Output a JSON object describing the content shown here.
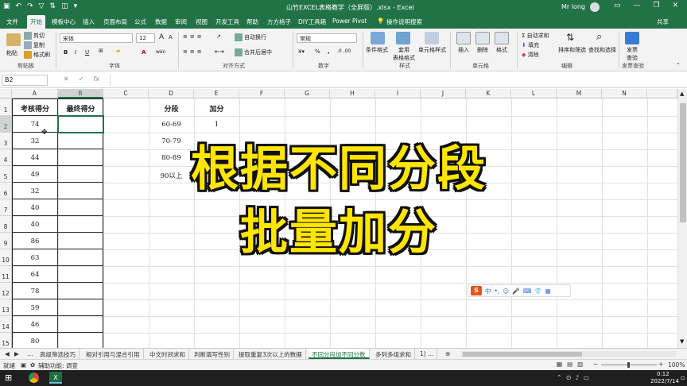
{
  "titlebar": {
    "title": "山竹EXCEL表格教学（全屏版）.xlsx  -  Excel",
    "user": "Mr long",
    "qat_icons": [
      "save-icon",
      "undo-icon",
      "redo-icon",
      "filter-icon",
      "sort-icon",
      "camera-icon",
      "more-icon"
    ]
  },
  "tabs": [
    "文件",
    "开始",
    "模板中心",
    "插入",
    "页面布局",
    "公式",
    "数据",
    "审阅",
    "视图",
    "开发工具",
    "帮助",
    "方方格子",
    "DIY工具箱",
    "Power Pivot",
    "操作说明搜索",
    "共享"
  ],
  "ribbon": {
    "clipboard": {
      "paste": "粘贴",
      "cut": "剪切",
      "copy": "复制",
      "format_painter": "格式刷",
      "group": "剪贴板"
    },
    "font": {
      "name": "宋体",
      "size": "12",
      "bold": "B",
      "italic": "I",
      "underline": "U",
      "grow": "A",
      "shrink": "A",
      "color_a": "A",
      "wen": "wén",
      "group": "字体"
    },
    "align": {
      "wrap": "自动换行",
      "merge": "合并后居中",
      "group": "对齐方式"
    },
    "number": {
      "format": "常规",
      "pct": "%",
      "comma": ",",
      "group": "数字"
    },
    "styles": {
      "cond": "条件格式",
      "table": "套用\n表格格式",
      "cell": "单元格样式",
      "group": "样式"
    },
    "cells": {
      "insert": "插入",
      "delete": "删除",
      "format": "格式",
      "group": "单元格"
    },
    "editing": {
      "autosum": "自动求和",
      "fill": "填充",
      "clear": "清除",
      "sort": "排序和筛选",
      "find": "查找和选择",
      "group": "编辑"
    },
    "check": {
      "label": "发票\n查验",
      "group": "发票查验"
    }
  },
  "formula_bar": {
    "name_box": "B2",
    "fx": "fx",
    "cancel": "✕",
    "enter": "✓",
    "value": ""
  },
  "columns": [
    "A",
    "B",
    "C",
    "D",
    "E",
    "F",
    "G",
    "H",
    "I",
    "J",
    "K",
    "L",
    "M",
    "N"
  ],
  "rows": [
    "1",
    "2",
    "3",
    "4",
    "5",
    "6",
    "7",
    "8",
    "9",
    "10",
    "11",
    "12",
    "13",
    "14",
    "15"
  ],
  "table1": {
    "headers": [
      "考核得分",
      "最终得分"
    ],
    "scores": [
      "74",
      "32",
      "44",
      "49",
      "32",
      "40",
      "40",
      "86",
      "63",
      "64",
      "78",
      "59",
      "46",
      "80"
    ]
  },
  "table2": {
    "headers": [
      "分段",
      "加分"
    ],
    "segments": [
      "60-69",
      "70-79",
      "80-89",
      "90以上"
    ],
    "bonus": [
      "1",
      "",
      "",
      ""
    ]
  },
  "overlay": {
    "line1": "根据不同分段",
    "line2": "批量加分"
  },
  "ime": {
    "label": "中"
  },
  "sheets": [
    "高级筛选技巧",
    "相对引用与混合引用",
    "中文时间求和",
    "判断填写性别",
    "提取重复3次以上的数据",
    "不同分段加不同分数",
    "多列多组求和",
    "1) ..."
  ],
  "active_sheet": 5,
  "status": {
    "ready": "就绪",
    "accessibility": "辅助功能: 调查",
    "zoom": "100%"
  },
  "taskbar": {
    "time": "0:12",
    "date": "2022/7/14"
  },
  "colors": {
    "excel_green": "#217346",
    "overlay_yellow": "#ffe600"
  }
}
